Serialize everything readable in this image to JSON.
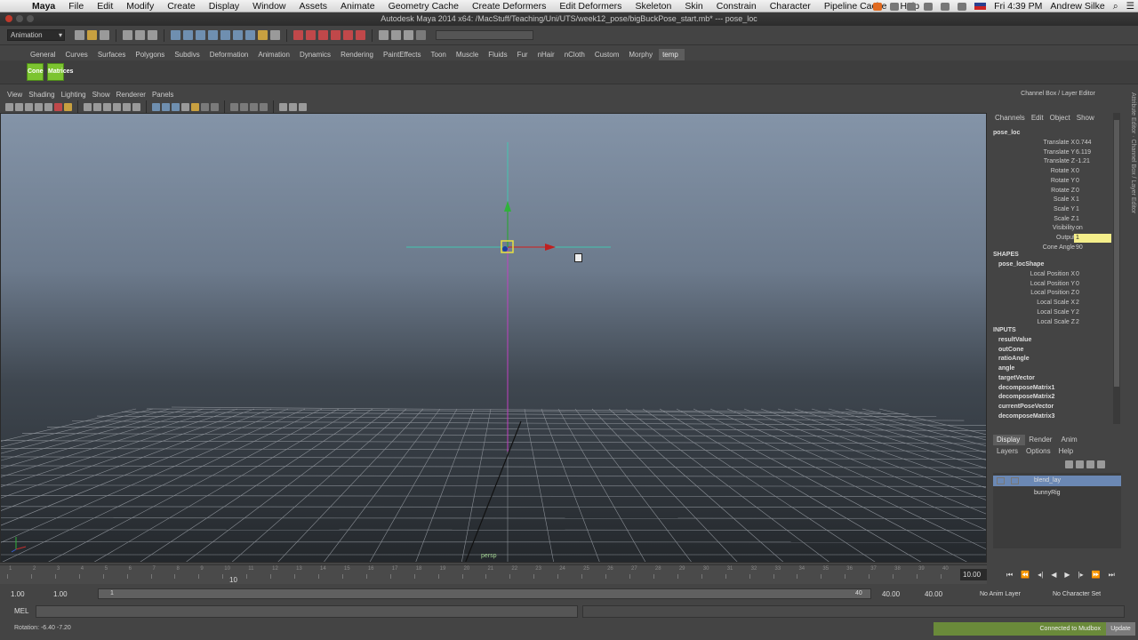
{
  "mac_menubar": {
    "app": "Maya",
    "items": [
      "File",
      "Edit",
      "Modify",
      "Create",
      "Display",
      "Window",
      "Assets",
      "Animate",
      "Geometry Cache",
      "Create Deformers",
      "Edit Deformers",
      "Skeleton",
      "Skin",
      "Constrain",
      "Character",
      "Pipeline Cache",
      "Help"
    ],
    "clock": "Fri 4:39 PM",
    "user": "Andrew Silke"
  },
  "window": {
    "title": "Autodesk Maya 2014 x64: /MacStuff/Teaching/Uni/UTS/week12_pose/bigBuckPose_start.mb*  ---  pose_loc"
  },
  "statusline": {
    "mode": "Animation"
  },
  "shelf": {
    "tabs": [
      "General",
      "Curves",
      "Surfaces",
      "Polygons",
      "Subdivs",
      "Deformation",
      "Animation",
      "Dynamics",
      "Rendering",
      "PaintEffects",
      "Toon",
      "Muscle",
      "Fluids",
      "Fur",
      "nHair",
      "nCloth",
      "Custom",
      "Morphy",
      "temp"
    ],
    "active_tab": "temp",
    "buttons": [
      "Cone",
      "Matrices"
    ]
  },
  "viewport": {
    "menus": [
      "View",
      "Shading",
      "Lighting",
      "Show",
      "Renderer",
      "Panels"
    ],
    "camera_label": "persp"
  },
  "channel_box": {
    "title": "Channel Box / Layer Editor",
    "menus": [
      "Channels",
      "Edit",
      "Object",
      "Show"
    ],
    "object": "pose_loc",
    "channels": [
      {
        "name": "Translate X",
        "value": "0.744"
      },
      {
        "name": "Translate Y",
        "value": "6.119"
      },
      {
        "name": "Translate Z",
        "value": "-1.21"
      },
      {
        "name": "Rotate X",
        "value": "0"
      },
      {
        "name": "Rotate Y",
        "value": "0"
      },
      {
        "name": "Rotate Z",
        "value": "0"
      },
      {
        "name": "Scale X",
        "value": "1"
      },
      {
        "name": "Scale Y",
        "value": "1"
      },
      {
        "name": "Scale Z",
        "value": "1"
      },
      {
        "name": "Visibility",
        "value": "on"
      },
      {
        "name": "Output",
        "value": "1"
      },
      {
        "name": "Cone Angle",
        "value": "90"
      }
    ],
    "shapes_label": "SHAPES",
    "shape_name": "pose_locShape",
    "shape_channels": [
      {
        "name": "Local Position X",
        "value": "0"
      },
      {
        "name": "Local Position Y",
        "value": "0"
      },
      {
        "name": "Local Position Z",
        "value": "0"
      },
      {
        "name": "Local Scale X",
        "value": "2"
      },
      {
        "name": "Local Scale Y",
        "value": "2"
      },
      {
        "name": "Local Scale Z",
        "value": "2"
      }
    ],
    "inputs_label": "INPUTS",
    "inputs": [
      "resultValue",
      "outCone",
      "ratioAngle",
      "angle",
      "targetVector",
      "decomposeMatrix1",
      "decomposeMatrix2",
      "currentPoseVector",
      "decomposeMatrix3"
    ]
  },
  "layer_editor": {
    "tabs": [
      "Display",
      "Render",
      "Anim"
    ],
    "menus": [
      "Layers",
      "Options",
      "Help"
    ],
    "layers": [
      "blend_lay",
      "bunnyRig"
    ]
  },
  "timeline": {
    "tick_labels": [
      "1",
      "2",
      "3",
      "4",
      "5",
      "6",
      "7",
      "8",
      "9",
      "10",
      "11",
      "12",
      "13",
      "14",
      "15",
      "16",
      "17",
      "18",
      "19",
      "20",
      "21",
      "22",
      "23",
      "24",
      "25",
      "26",
      "27",
      "28",
      "29",
      "30",
      "31",
      "32",
      "33",
      "34",
      "35",
      "36",
      "37",
      "38",
      "39",
      "40"
    ],
    "current_frame_label": "10",
    "current_frame": "10.00"
  },
  "range": {
    "start": "1.00",
    "anim_start": "1.00",
    "range_start": "1",
    "range_end": "40",
    "anim_end": "40.00",
    "end": "40.00",
    "anim_layer": "No Anim Layer",
    "character_set": "No Character Set"
  },
  "command_line": {
    "label": "MEL"
  },
  "help_line": {
    "text": "Rotation:   -6.40      -7.20",
    "mudbox": "Connected to Mudbox",
    "update": "Update"
  }
}
